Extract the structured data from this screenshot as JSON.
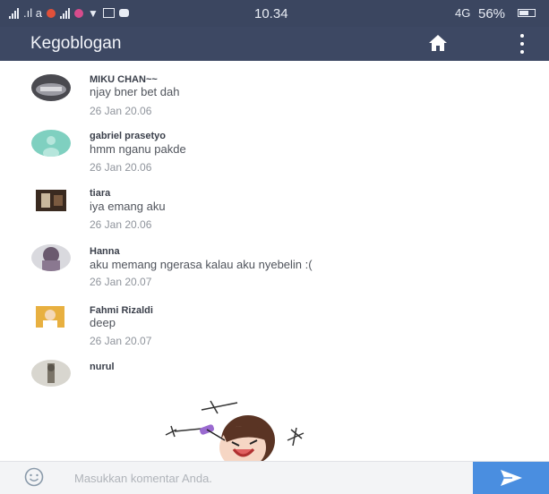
{
  "status_bar": {
    "carrier_glyphs": ".ıl a",
    "time": "10.34",
    "battery_percent": "56%",
    "network": "4G"
  },
  "app_bar": {
    "title": "Kegoblogan",
    "home_icon": "home-icon",
    "more_icon": "more-vertical-icon"
  },
  "comments": [
    {
      "name": "MIKU CHAN~~",
      "text": "njay bner bet dah",
      "time": "26 Jan 20.06"
    },
    {
      "name": "gabriel prasetyo",
      "text": "hmm nganu pakde",
      "time": "26 Jan 20.06"
    },
    {
      "name": "tiara",
      "text": "iya emang aku",
      "time": "26 Jan 20.06"
    },
    {
      "name": "Hanna",
      "text": "aku memang ngerasa kalau aku nyebelin :(",
      "time": "26 Jan 20.07"
    },
    {
      "name": "Fahmi Rizaldi",
      "text": "deep",
      "time": "26 Jan 20.07"
    },
    {
      "name": "nurul",
      "text": "",
      "time": ""
    }
  ],
  "input_bar": {
    "placeholder": "Masukkan komentar Anda.",
    "emoji_icon": "smiley-icon",
    "send_icon": "send-icon"
  },
  "colors": {
    "app_bar": "#3d4863",
    "status_bar": "#3b4660",
    "send_button": "#4a8ee0",
    "default_avatar": "#7fd0c0"
  }
}
